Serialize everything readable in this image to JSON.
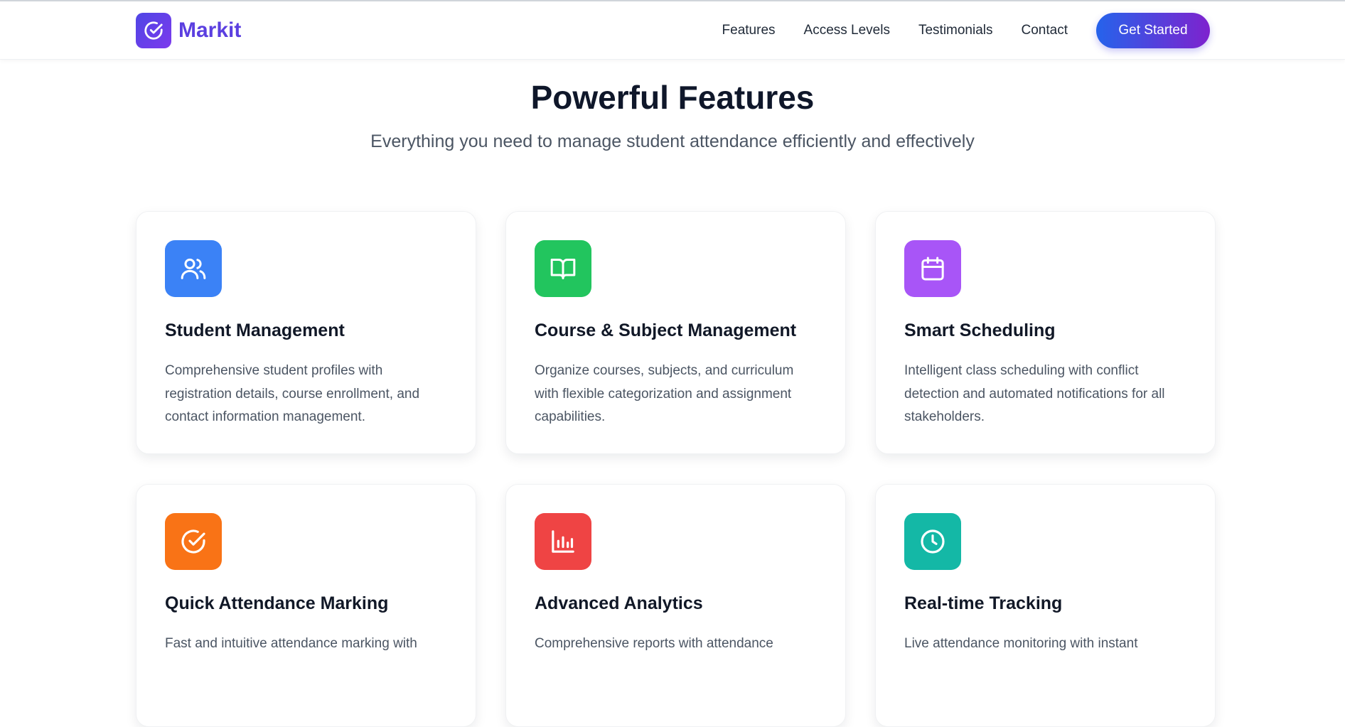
{
  "brand": {
    "name": "Markit",
    "logo_icon": "check-circle-icon"
  },
  "nav": {
    "links": [
      "Features",
      "Access Levels",
      "Testimonials",
      "Contact"
    ],
    "cta": "Get Started"
  },
  "hero": {
    "title": "Powerful Features",
    "subtitle": "Everything you need to manage student attendance efficiently and effectively"
  },
  "features": [
    {
      "title": "Student Management",
      "desc": "Comprehensive student profiles with registration details, course enrollment, and contact information management.",
      "icon": "users-icon",
      "color": "#3b82f6"
    },
    {
      "title": "Course & Subject Management",
      "desc": "Organize courses, subjects, and curriculum with flexible categorization and assignment capabilities.",
      "icon": "book-open-icon",
      "color": "#22c55e"
    },
    {
      "title": "Smart Scheduling",
      "desc": "Intelligent class scheduling with conflict detection and automated notifications for all stakeholders.",
      "icon": "calendar-icon",
      "color": "#a855f7"
    },
    {
      "title": "Quick Attendance Marking",
      "desc": "Fast and intuitive attendance marking with",
      "icon": "check-circle-icon",
      "color": "#f97316"
    },
    {
      "title": "Advanced Analytics",
      "desc": "Comprehensive reports with attendance",
      "icon": "bar-chart-icon",
      "color": "#ef4444"
    },
    {
      "title": "Real-time Tracking",
      "desc": "Live attendance monitoring with instant",
      "icon": "clock-icon",
      "color": "#14b8a6"
    }
  ]
}
